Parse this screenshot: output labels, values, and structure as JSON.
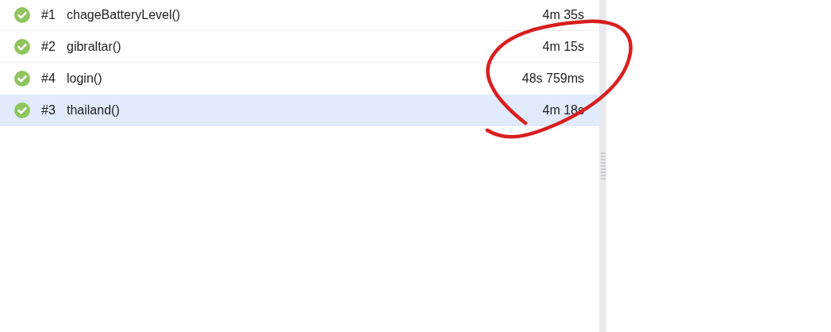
{
  "tests": [
    {
      "passed": true,
      "number": "#1",
      "name": "chageBatteryLevel()",
      "duration": "4m 35s",
      "selected": false
    },
    {
      "passed": true,
      "number": "#2",
      "name": "gibraltar()",
      "duration": "4m 15s",
      "selected": false
    },
    {
      "passed": true,
      "number": "#4",
      "name": "login()",
      "duration": "48s 759ms",
      "selected": false
    },
    {
      "passed": true,
      "number": "#3",
      "name": "thailand()",
      "duration": "4m 18s",
      "selected": true
    }
  ]
}
